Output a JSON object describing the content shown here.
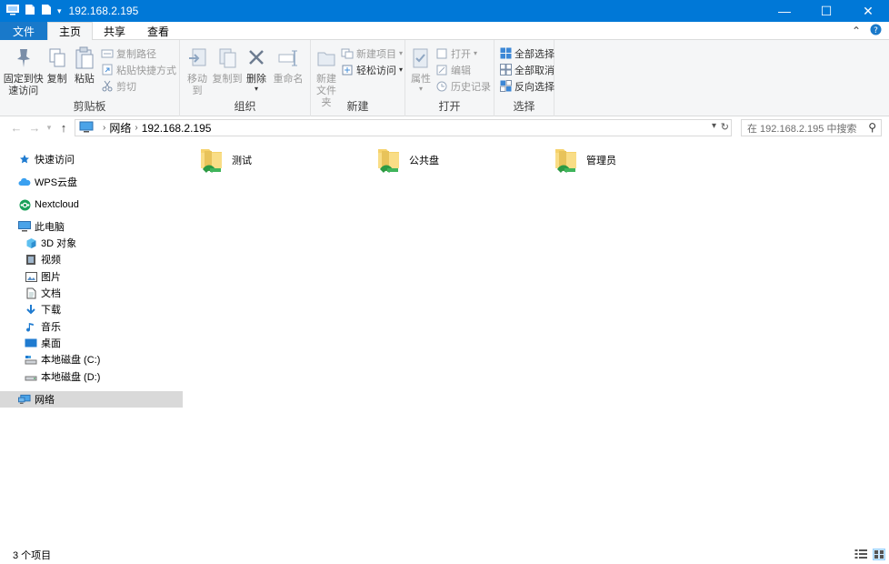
{
  "window": {
    "title": "192.168.2.195",
    "controls": {
      "minimize": "—",
      "maximize": "☐",
      "close": "✕"
    }
  },
  "ribbon_tabs": [
    "文件",
    "主页",
    "共享",
    "查看"
  ],
  "ribbon": {
    "clipboard": {
      "label": "剪贴板",
      "pin": "固定到快\n速访问",
      "copy": "复制",
      "paste": "粘贴",
      "copy_path": "复制路径",
      "paste_shortcut": "粘贴快捷方式",
      "cut": "剪切"
    },
    "organize": {
      "label": "组织",
      "move_to": "移动到",
      "copy_to": "复制到",
      "delete": "删除",
      "rename": "重命名"
    },
    "new": {
      "label": "新建",
      "new_folder": "新建\n文件夹",
      "new_item": "新建项目",
      "easy_access": "轻松访问"
    },
    "open": {
      "label": "打开",
      "properties": "属性",
      "open": "打开",
      "edit": "编辑",
      "history": "历史记录"
    },
    "select": {
      "label": "选择",
      "select_all": "全部选择",
      "select_none": "全部取消",
      "invert": "反向选择"
    }
  },
  "address": {
    "crumbs": [
      "网络",
      "192.168.2.195"
    ],
    "search_placeholder": "在 192.168.2.195 中搜索"
  },
  "nav_pane": [
    {
      "label": "快速访问",
      "icon": "star-icon",
      "indent": 0
    },
    {
      "label": "WPS云盘",
      "icon": "cloud-icon",
      "indent": 0
    },
    {
      "label": "Nextcloud",
      "icon": "nextcloud-icon",
      "indent": 0
    },
    {
      "label": "此电脑",
      "icon": "computer-icon",
      "indent": 0
    },
    {
      "label": "3D 对象",
      "icon": "cube-icon",
      "indent": 1
    },
    {
      "label": "视频",
      "icon": "video-icon",
      "indent": 1
    },
    {
      "label": "图片",
      "icon": "picture-icon",
      "indent": 1
    },
    {
      "label": "文档",
      "icon": "document-icon",
      "indent": 1
    },
    {
      "label": "下载",
      "icon": "download-icon",
      "indent": 1
    },
    {
      "label": "音乐",
      "icon": "music-icon",
      "indent": 1
    },
    {
      "label": "桌面",
      "icon": "desktop-icon",
      "indent": 1
    },
    {
      "label": "本地磁盘 (C:)",
      "icon": "drive-c-icon",
      "indent": 1
    },
    {
      "label": "本地磁盘 (D:)",
      "icon": "drive-d-icon",
      "indent": 1
    },
    {
      "label": "网络",
      "icon": "network-icon",
      "indent": 0,
      "selected": true
    }
  ],
  "items": [
    {
      "name": "测试"
    },
    {
      "name": "公共盘"
    },
    {
      "name": "管理员"
    }
  ],
  "status": {
    "count": "3 个项目"
  },
  "colors": {
    "titlebar": "#0078d7",
    "file_tab": "#1979ca",
    "ribbon_bg": "#f5f6f7",
    "selection": "#d9d9d9"
  }
}
